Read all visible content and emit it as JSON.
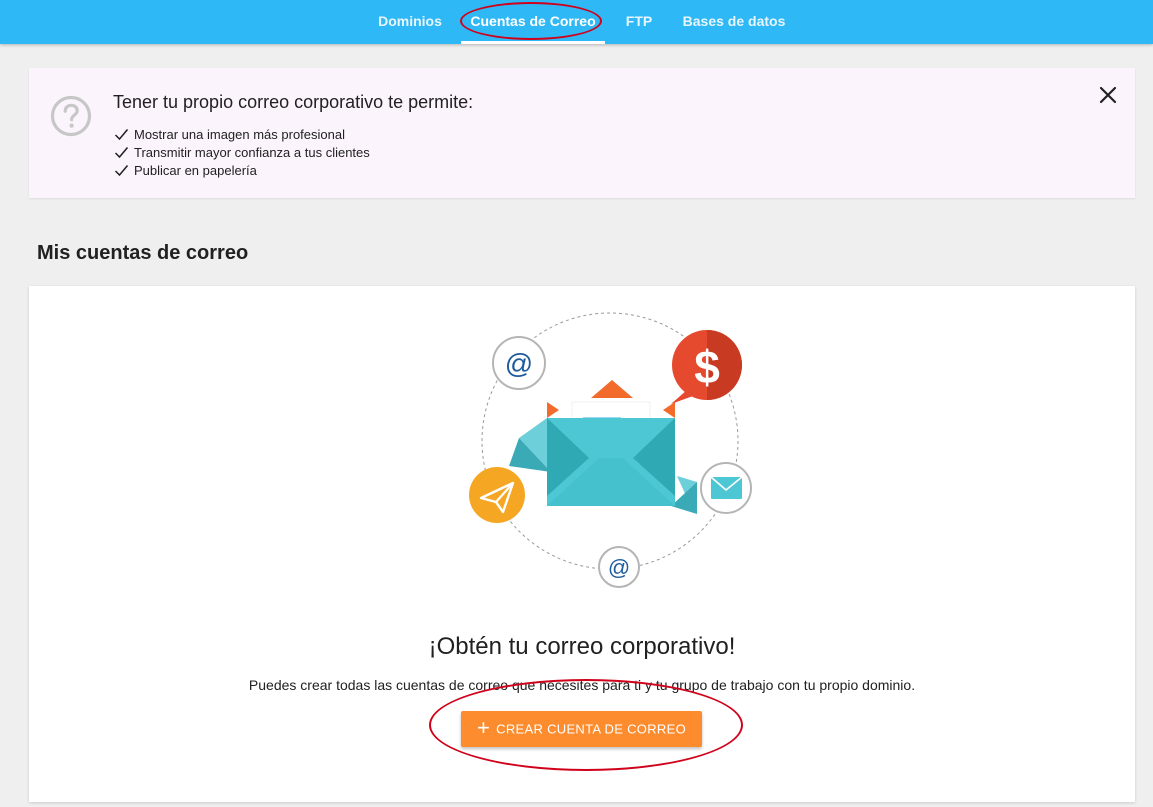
{
  "nav": {
    "tabs": [
      {
        "label": "Dominios",
        "active": false
      },
      {
        "label": "Cuentas de Correo",
        "active": true
      },
      {
        "label": "FTP",
        "active": false
      },
      {
        "label": "Bases de datos",
        "active": false
      }
    ]
  },
  "banner": {
    "title": "Tener tu propio correo corporativo te permite:",
    "items": [
      "Mostrar una imagen más profesional",
      "Transmitir mayor confianza a tus clientes",
      "Publicar en papelería"
    ],
    "icon": "help-circle-icon",
    "close_icon": "close-icon"
  },
  "section": {
    "title": "Mis cuentas de correo"
  },
  "card": {
    "illustration_symbols": {
      "at": "@",
      "dollar": "$"
    },
    "headline": "¡Obtén tu correo corporativo!",
    "subtext": "Puedes crear todas las cuentas de correo que necesites para ti y tu grupo de trabajo con tu propio dominio.",
    "button_icon": "plus-icon",
    "button_label": "CREAR CUENTA DE CORREO"
  },
  "colors": {
    "nav_bg": "#2fb8f6",
    "banner_bg": "#fcf4fd",
    "button_bg": "#fc8c2d",
    "annotation": "#d0021b",
    "envelope": "#4ec7d4",
    "coin": "#e64a2e"
  }
}
